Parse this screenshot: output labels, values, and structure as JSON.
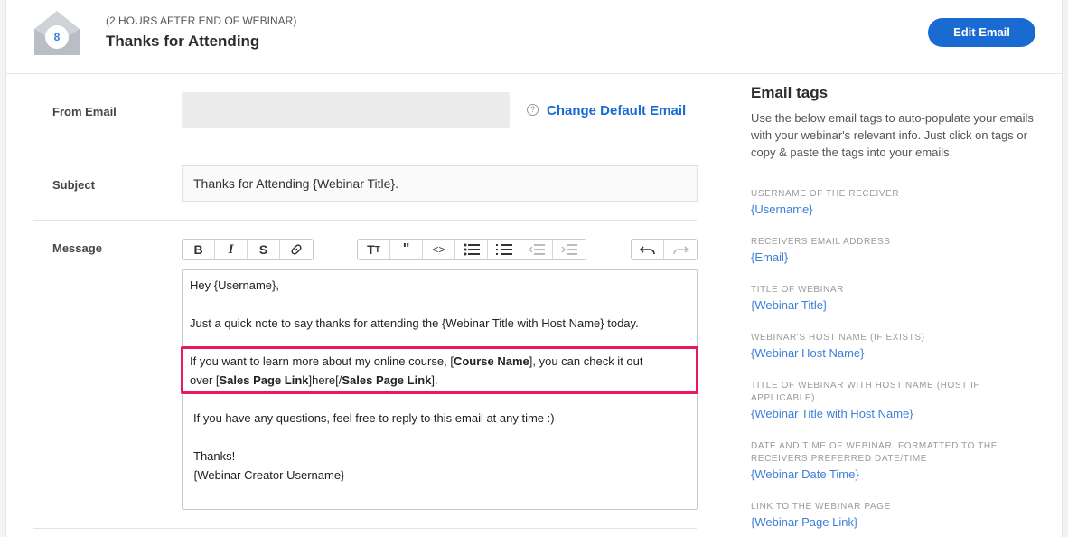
{
  "header": {
    "step_number": "8",
    "timing": "(2 HOURS AFTER END OF WEBINAR)",
    "title": "Thanks for Attending",
    "edit_button": "Edit Email"
  },
  "form": {
    "from_label": "From Email",
    "from_value": "",
    "change_default_label": "Change Default Email",
    "subject_label": "Subject",
    "subject_value": "Thanks for Attending {Webinar Title}.",
    "message_label": "Message"
  },
  "toolbar": {
    "format_group": [
      "bold",
      "italic",
      "strikethrough",
      "link"
    ],
    "block_group": [
      "text-size",
      "blockquote",
      "code",
      "bullet-list",
      "numbered-list",
      "outdent",
      "indent"
    ],
    "history_group": [
      "undo",
      "redo"
    ]
  },
  "message": {
    "line1": "Hey {Username},",
    "line2": "Just a quick note to say thanks for attending the {Webinar Title with Host Name} today.",
    "line3_a": "If you want to learn more about my online course, [",
    "line3_b": "Course Name",
    "line3_c": "], you can check it out",
    "line4_a": "over [",
    "line4_b": "Sales Page Link",
    "line4_c": "]here[/",
    "line4_d": "Sales Page Link",
    "line4_e": "].",
    "line5": "If you have any questions, feel free to reply to this email at any time :)",
    "line6": "Thanks!",
    "line7": "{Webinar Creator Username}"
  },
  "highlight_color": "#e8195f",
  "email_tags": {
    "title": "Email tags",
    "description": "Use the below email tags to auto-populate your emails with your webinar's relevant info. Just click on tags or copy & paste the tags into your emails.",
    "items": [
      {
        "caption": "USERNAME OF THE RECEIVER",
        "tag": "{Username}"
      },
      {
        "caption": "RECEIVERS EMAIL ADDRESS",
        "tag": "{Email}"
      },
      {
        "caption": "TITLE OF WEBINAR",
        "tag": "{Webinar Title}"
      },
      {
        "caption": "WEBINAR'S HOST NAME (IF EXISTS)",
        "tag": "{Webinar Host Name}"
      },
      {
        "caption": "TITLE OF WEBINAR WITH HOST NAME (HOST IF APPLICABLE)",
        "tag": "{Webinar Title with Host Name}"
      },
      {
        "caption": "DATE AND TIME OF WEBINAR. FORMATTED TO THE RECEIVERS PREFERRED DATE/TIME",
        "tag": "{Webinar Date Time}"
      },
      {
        "caption": "LINK TO THE WEBINAR PAGE",
        "tag": "{Webinar Page Link}"
      }
    ]
  }
}
